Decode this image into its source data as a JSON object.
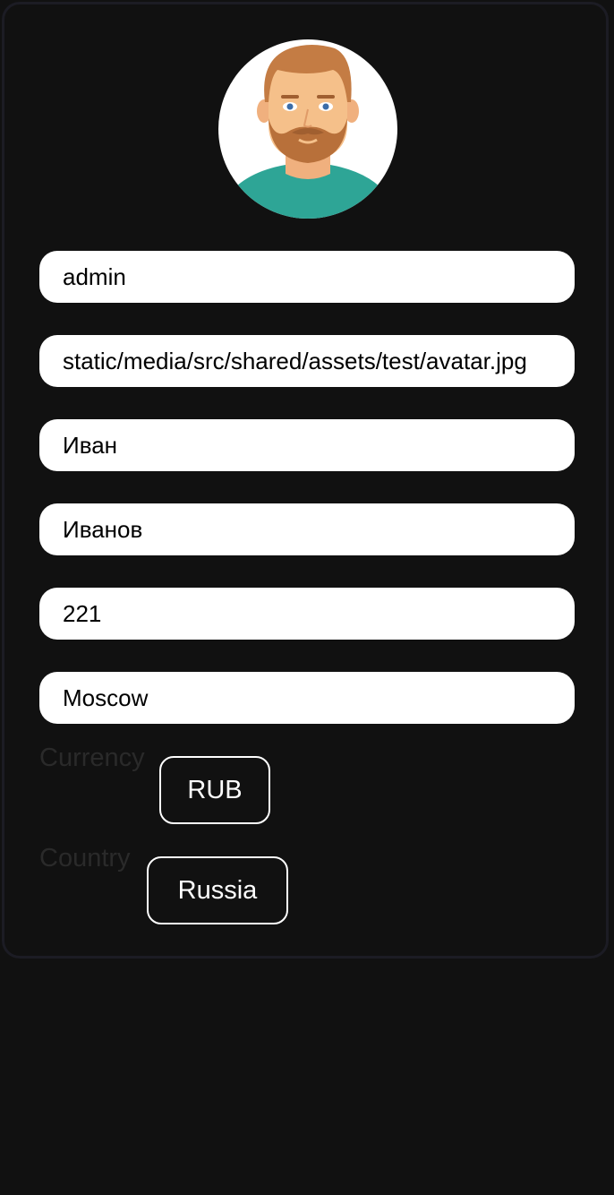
{
  "profile": {
    "avatar_icon": "user-avatar-bearded-man",
    "fields": {
      "username": "admin",
      "avatar": "static/media/src/shared/assets/test/avatar.jpg",
      "first_name": "Иван",
      "last_name": "Иванов",
      "age": "221",
      "city": "Moscow"
    },
    "currency": {
      "label": "Currency",
      "value": "RUB"
    },
    "country": {
      "label": "Country",
      "value": "Russia"
    }
  },
  "colors": {
    "background": "#111111",
    "card_border": "#1c1c24",
    "field_bg": "#ffffff",
    "avatar_shirt": "#2ea596",
    "avatar_skin": "#f5c08a",
    "avatar_hair": "#c47c44"
  }
}
